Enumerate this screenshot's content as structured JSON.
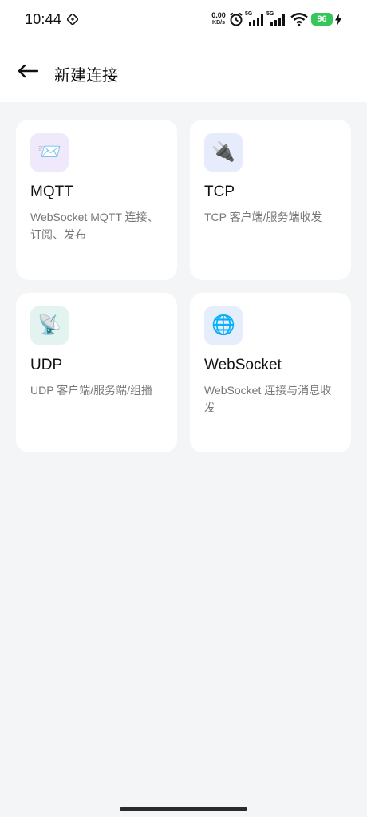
{
  "status_bar": {
    "time": "10:44",
    "net_speed_value": "0.00",
    "net_speed_unit": "KB/s",
    "signal1_label": "5G",
    "signal2_label": "5G",
    "battery": "96",
    "icons": [
      "nfc-icon",
      "alarm-icon",
      "signal-icon",
      "wifi-icon",
      "charging-icon"
    ]
  },
  "header": {
    "title": "新建连接",
    "back_icon": "arrow-left-icon"
  },
  "cards": [
    {
      "title": "MQTT",
      "description": "WebSocket MQTT 连接、订阅、发布",
      "icon": "envelope-icon",
      "icon_glyph": "📨",
      "icon_bg": "#f0e8fb"
    },
    {
      "title": "TCP",
      "description": "TCP 客户端/服务端收发",
      "icon": "plug-icon",
      "icon_glyph": "🔌",
      "icon_bg": "#e6ecfb"
    },
    {
      "title": "UDP",
      "description": "UDP 客户端/服务端/组播",
      "icon": "satellite-dish-icon",
      "icon_glyph": "📡",
      "icon_bg": "#e3f3f0"
    },
    {
      "title": "WebSocket",
      "description": "WebSocket 连接与消息收发",
      "icon": "globe-icon",
      "icon_glyph": "🌐",
      "icon_bg": "#e6eefb"
    }
  ],
  "colors": {
    "page_bg": "#f4f5f7",
    "header_bg": "#ffffff",
    "card_bg": "#ffffff",
    "battery_green": "#35c759",
    "desc_text": "#777777"
  }
}
